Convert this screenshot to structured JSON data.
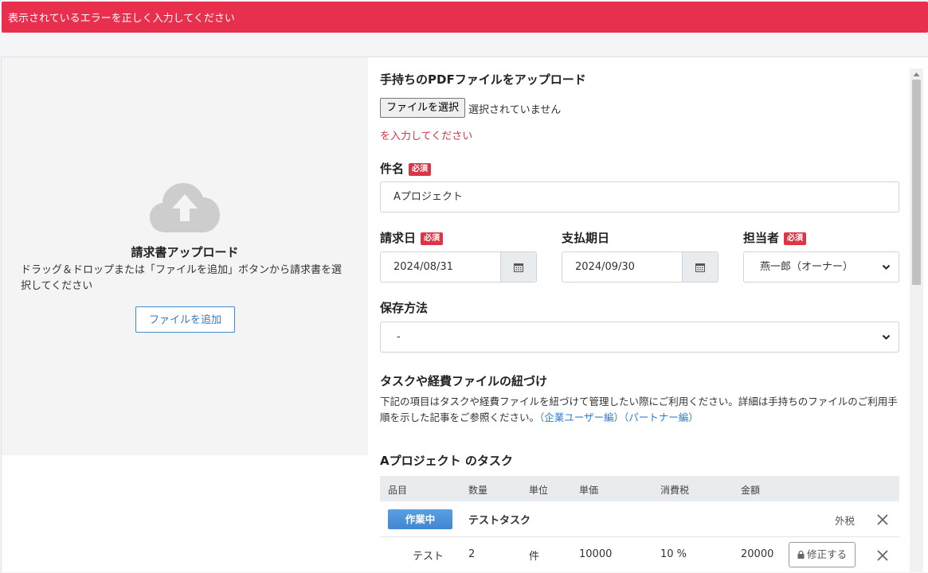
{
  "alert": {
    "message": "表示されているエラーを正しく入力してください"
  },
  "upload": {
    "title": "請求書アップロード",
    "description": "ドラッグ＆ドロップまたは「ファイルを追加」ボタンから請求書を選択してください",
    "add_button": "ファイルを追加",
    "icon": "cloud-upload-icon"
  },
  "pdf": {
    "heading": "手持ちのPDFファイルをアップロード",
    "file_button": "ファイルを選択",
    "file_status": "選択されていません",
    "error": "を入力してください"
  },
  "required_badge": "必須",
  "subject": {
    "label": "件名",
    "value": "Aプロジェクト"
  },
  "invoice_date": {
    "label": "請求日",
    "value": "2024/08/31"
  },
  "due_date": {
    "label": "支払期日",
    "value": "2024/09/30"
  },
  "assignee": {
    "label": "担当者",
    "value": "燕一郎（オーナー）"
  },
  "storage": {
    "label": "保存方法",
    "value": "-"
  },
  "linking": {
    "heading": "タスクや経費ファイルの紐づけ",
    "description": "下記の項目はタスクや経費ファイルを紐づけて管理したい際にご利用ください。詳細は手持ちのファイルのご利用手順を示した記事をご参照ください。",
    "link_enterprise": "（企業ユーザー編）",
    "link_partner": "（パートナー編）"
  },
  "tasks": {
    "heading": "Aプロジェクト のタスク",
    "columns": [
      "品目",
      "数量",
      "単位",
      "単価",
      "消費税",
      "金額"
    ],
    "task": {
      "status": "作業中",
      "name": "テストタスク",
      "tax_mode": "外税"
    },
    "items": [
      {
        "name": "テスト",
        "qty": "2",
        "unit": "件",
        "price": "10000",
        "tax": "10 %",
        "amount": "20000",
        "edit_label": "修正する"
      }
    ]
  }
}
